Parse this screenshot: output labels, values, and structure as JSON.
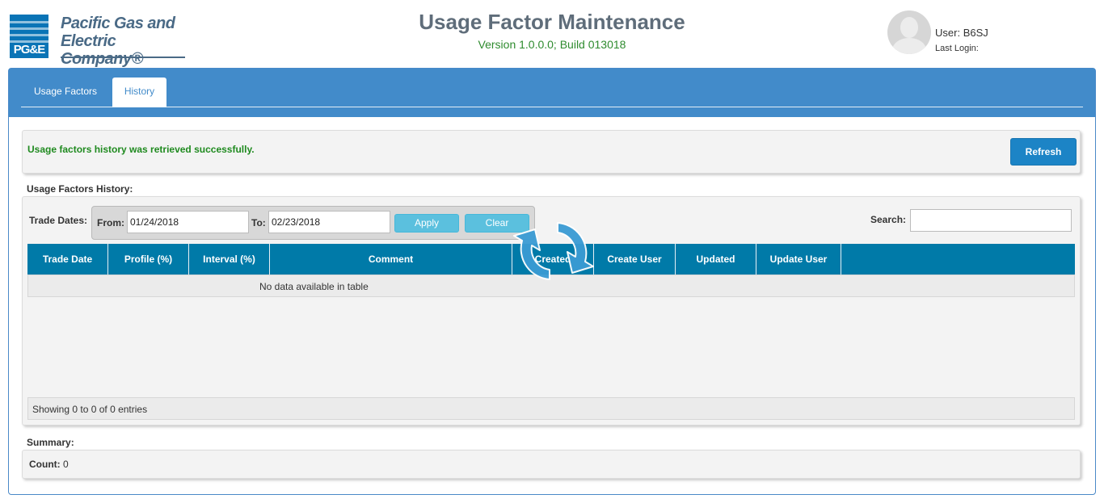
{
  "header": {
    "logo_mark": "PG&E",
    "logo_line1": "Pacific Gas and",
    "logo_line2": "Electric Company®",
    "title": "Usage Factor Maintenance",
    "version": "Version 1.0.0.0; Build 013018",
    "user_label": "User:",
    "user_name": "B6SJ",
    "last_login": "Last Login:"
  },
  "tabs": [
    {
      "label": "Usage Factors",
      "active": false
    },
    {
      "label": "History",
      "active": true
    }
  ],
  "message": {
    "text": "Usage factors history was retrieved successfully.",
    "refresh_label": "Refresh"
  },
  "history": {
    "section_label": "Usage Factors History:",
    "trade_dates_label": "Trade Dates:",
    "from_label": "From:",
    "from_value": "01/24/2018",
    "to_label": "To:",
    "to_value": "02/23/2018",
    "apply_label": "Apply",
    "clear_label": "Clear",
    "search_label": "Search:",
    "search_value": "",
    "columns": [
      "Trade Date",
      "Profile (%)",
      "Interval (%)",
      "Comment",
      "Created",
      "Create User",
      "Updated",
      "Update User"
    ],
    "empty_text": "No data available in table",
    "footer_text": "Showing 0 to 0 of 0 entries"
  },
  "summary": {
    "section_label": "Summary:",
    "count_label": "Count:",
    "count_value": "0"
  },
  "colors": {
    "brand_blue": "#428bca",
    "table_header": "#007aa8",
    "success_green": "#1f8a1f",
    "refresh_button": "#1c84c6",
    "info_button": "#5bc0de"
  },
  "icons": {
    "loading": "refresh-spinner-icon",
    "avatar": "user-avatar-icon"
  }
}
